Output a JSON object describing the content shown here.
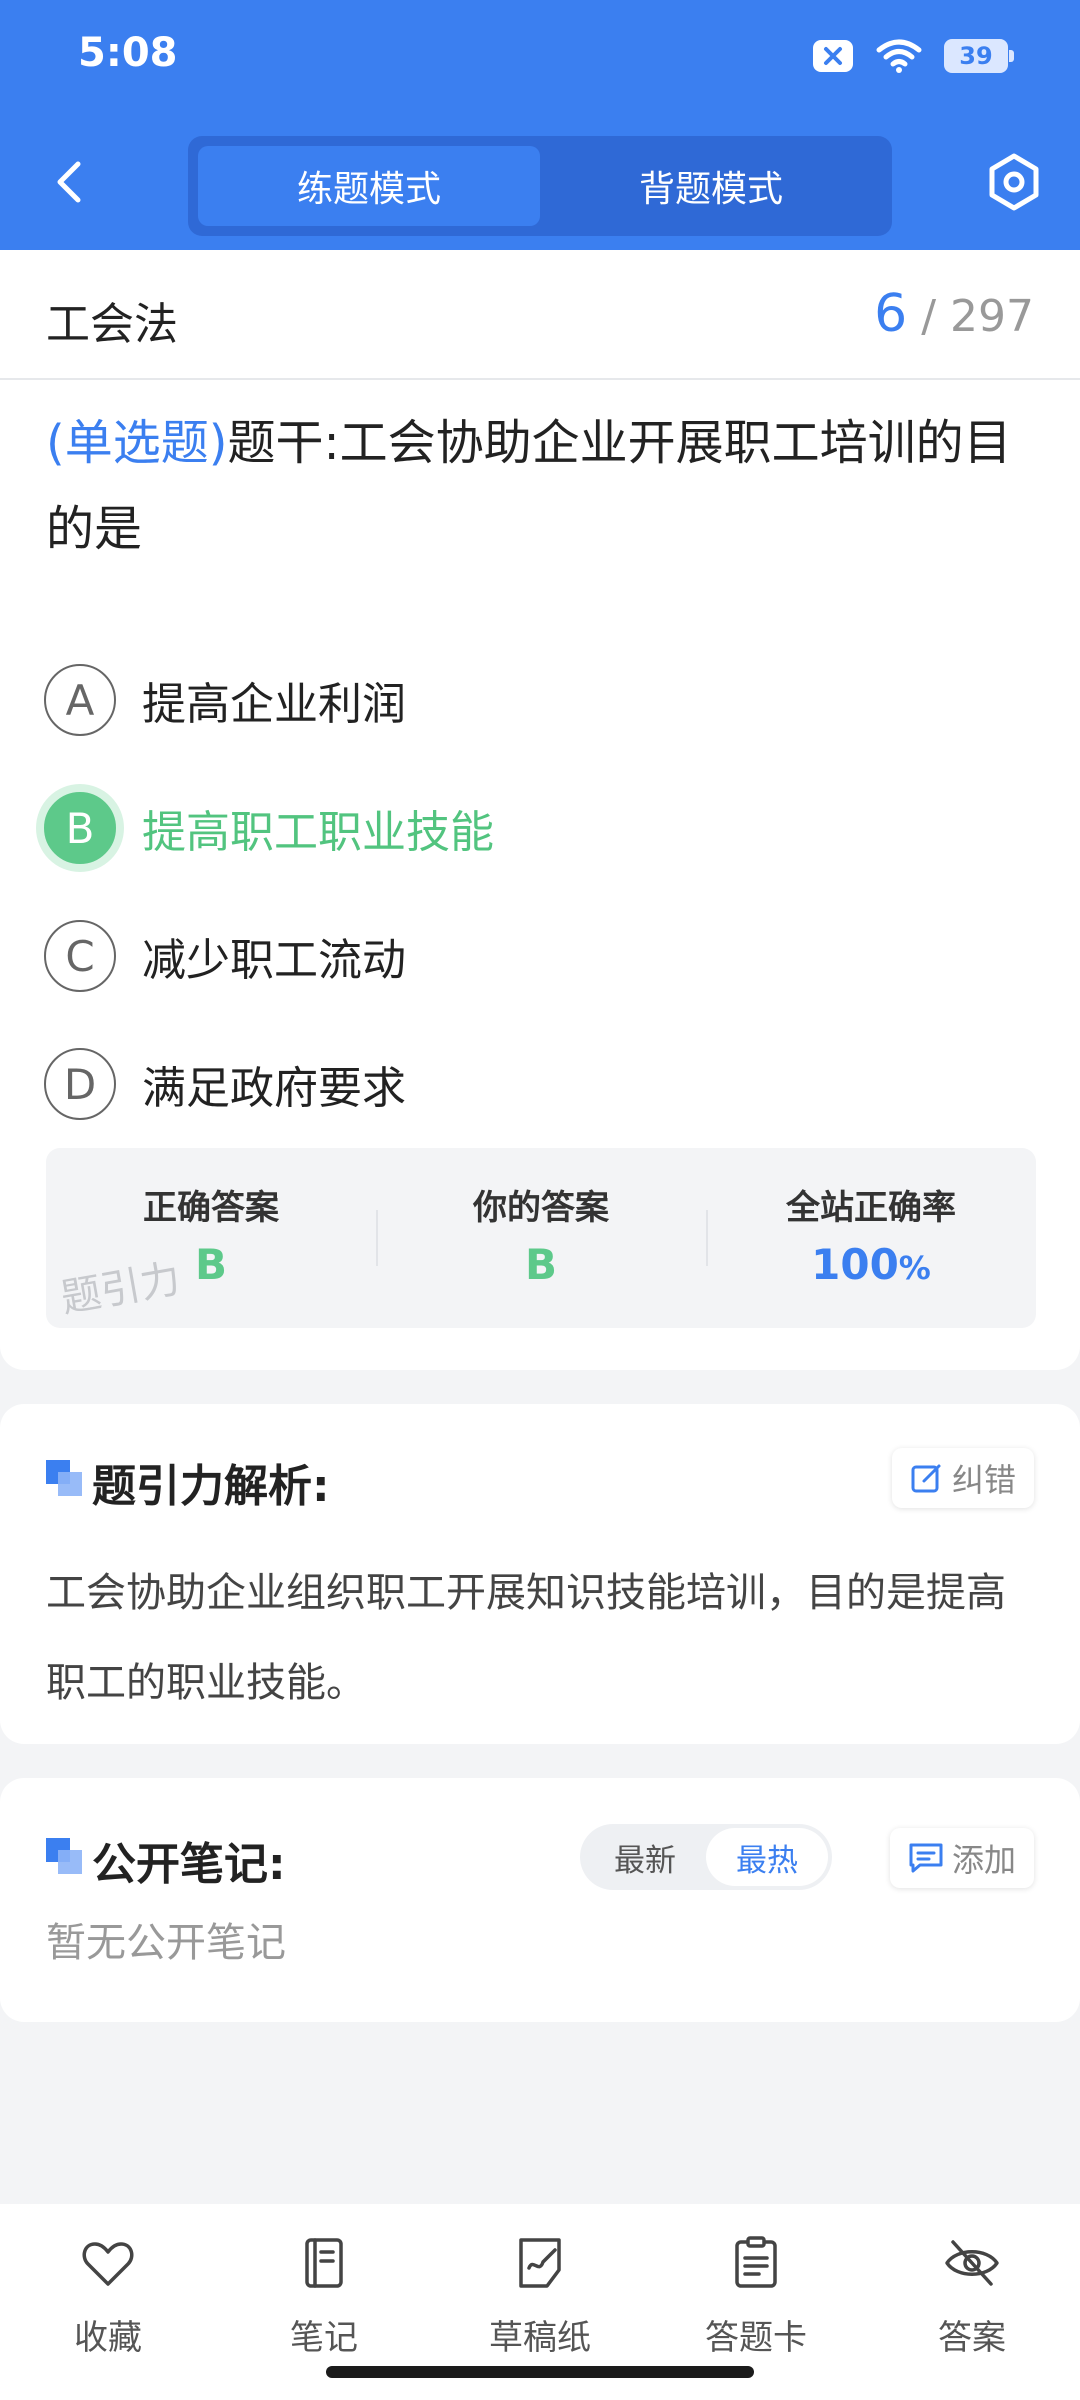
{
  "status_bar": {
    "time": "5:08",
    "battery": "39"
  },
  "header": {
    "tabs": [
      {
        "label": "练题模式",
        "active": true
      },
      {
        "label": "背题模式",
        "active": false
      }
    ]
  },
  "subject": {
    "title": "工会法",
    "current": "6",
    "separator": "/",
    "total": "297"
  },
  "question": {
    "type": "(单选题)",
    "stem": "题干:工会协助企业开展职工培训的目的是",
    "options": [
      {
        "letter": "A",
        "text": "提高企业利润"
      },
      {
        "letter": "B",
        "text": "提高职工职业技能"
      },
      {
        "letter": "C",
        "text": "减少职工流动"
      },
      {
        "letter": "D",
        "text": "满足政府要求"
      }
    ]
  },
  "stats": {
    "correct_label": "正确答案",
    "correct_value": "B",
    "yours_label": "你的答案",
    "yours_value": "B",
    "rate_label": "全站正确率",
    "rate_value": "100",
    "rate_unit": "%",
    "watermark": "题引力"
  },
  "analysis": {
    "title": "题引力解析:",
    "correct_btn": "纠错",
    "text": "工会协助企业组织职工开展知识技能培训，目的是提高职工的职业技能。"
  },
  "notes": {
    "title": "公开笔记:",
    "sort_options": [
      "最新",
      "最热"
    ],
    "active_sort": "最热",
    "add_btn": "添加",
    "empty": "暂无公开笔记"
  },
  "bottom_bar": {
    "items": [
      {
        "label": "收藏",
        "icon": "heart-icon"
      },
      {
        "label": "笔记",
        "icon": "notebook-icon"
      },
      {
        "label": "草稿纸",
        "icon": "draft-paper-icon"
      },
      {
        "label": "答题卡",
        "icon": "answer-sheet-icon"
      },
      {
        "label": "答案",
        "icon": "eye-off-icon"
      }
    ]
  },
  "colors": {
    "primary": "#3b7ff0",
    "correct": "#5dc98a"
  }
}
